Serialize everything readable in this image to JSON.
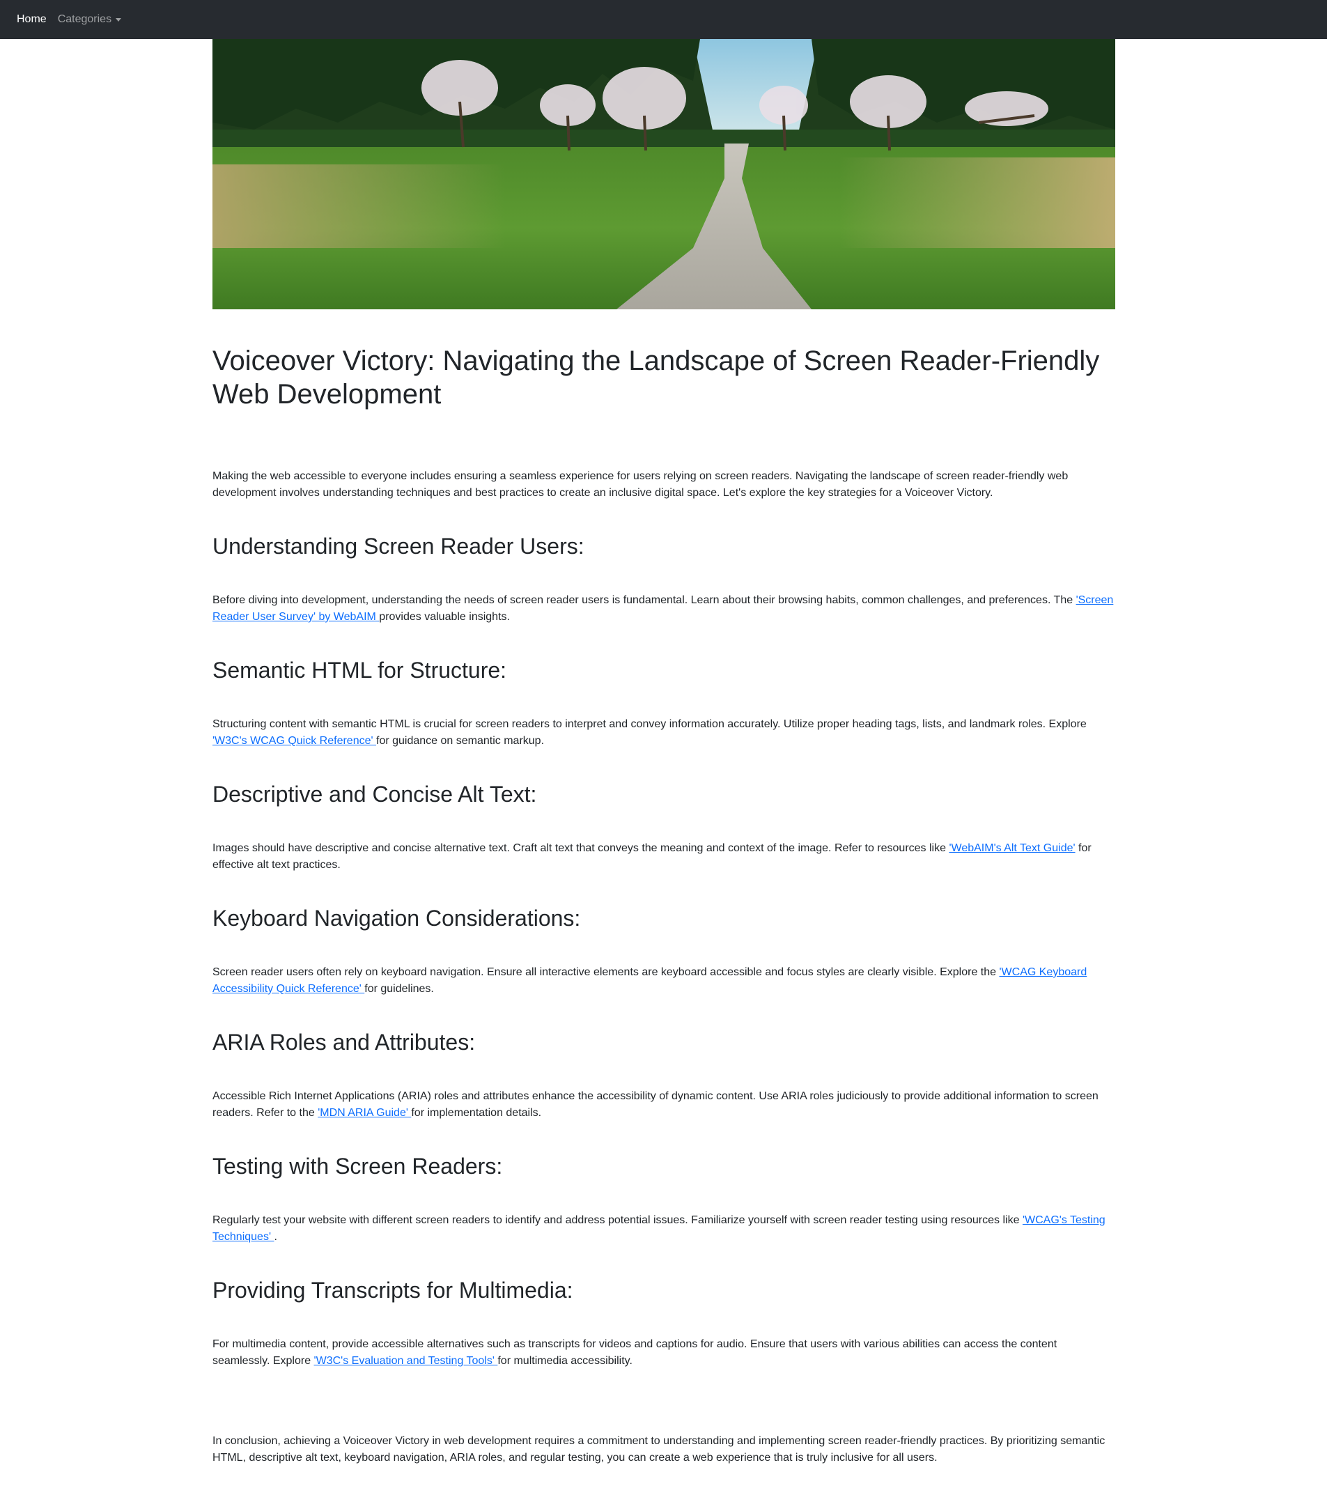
{
  "navbar": {
    "home_label": "Home",
    "categories_label": "Categories"
  },
  "hero": {
    "alt": "Gravel path through a grassy meadow lined with flowering trees"
  },
  "article": {
    "title": "Voiceover Victory: Navigating the Landscape of Screen Reader-Friendly Web Development",
    "intro": "Making the web accessible to everyone includes ensuring a seamless experience for users relying on screen readers. Navigating the landscape of screen reader-friendly web development involves understanding techniques and best practices to create an inclusive digital space. Let's explore the key strategies for a Voiceover Victory.",
    "sections": [
      {
        "heading": "Understanding Screen Reader Users:",
        "before": "Before diving into development, understanding the needs of screen reader users is fundamental. Learn about their browsing habits, common challenges, and preferences. The ",
        "link": "'Screen Reader User Survey' by WebAIM ",
        "after": "provides valuable insights."
      },
      {
        "heading": "Semantic HTML for Structure:",
        "before": "Structuring content with semantic HTML is crucial for screen readers to interpret and convey information accurately. Utilize proper heading tags, lists, and landmark roles. Explore ",
        "link": "'W3C's WCAG Quick Reference' ",
        "after": "for guidance on semantic markup."
      },
      {
        "heading": "Descriptive and Concise Alt Text:",
        "before": "Images should have descriptive and concise alternative text. Craft alt text that conveys the meaning and context of the image. Refer to resources like ",
        "link": "'WebAIM's Alt Text Guide'",
        "after": " for effective alt text practices."
      },
      {
        "heading": "Keyboard Navigation Considerations:",
        "before": "Screen reader users often rely on keyboard navigation. Ensure all interactive elements are keyboard accessible and focus styles are clearly visible. Explore the ",
        "link": "'WCAG Keyboard Accessibility Quick Reference' ",
        "after": "for guidelines."
      },
      {
        "heading": "ARIA Roles and Attributes:",
        "before": "Accessible Rich Internet Applications (ARIA) roles and attributes enhance the accessibility of dynamic content. Use ARIA roles judiciously to provide additional information to screen readers. Refer to the ",
        "link": "'MDN ARIA Guide' ",
        "after": "for implementation details."
      },
      {
        "heading": "Testing with Screen Readers:",
        "before": "Regularly test your website with different screen readers to identify and address potential issues. Familiarize yourself with screen reader testing using resources like ",
        "link": "'WCAG's Testing Techniques' ",
        "after": "."
      },
      {
        "heading": "Providing Transcripts for Multimedia:",
        "before": "For multimedia content, provide accessible alternatives such as transcripts for videos and captions for audio. Ensure that users with various abilities can access the content seamlessly. Explore ",
        "link": "'W3C's Evaluation and Testing Tools' ",
        "after": "for multimedia accessibility."
      }
    ],
    "conclusion": "In conclusion, achieving a Voiceover Victory in web development requires a commitment to understanding and implementing screen reader-friendly practices. By prioritizing semantic HTML, descriptive alt text, keyboard navigation, ARIA roles, and regular testing, you can create a web experience that is truly inclusive for all users."
  },
  "colors": {
    "navbar_bg": "#272b30",
    "link": "#0d6efd",
    "text": "#212529"
  }
}
